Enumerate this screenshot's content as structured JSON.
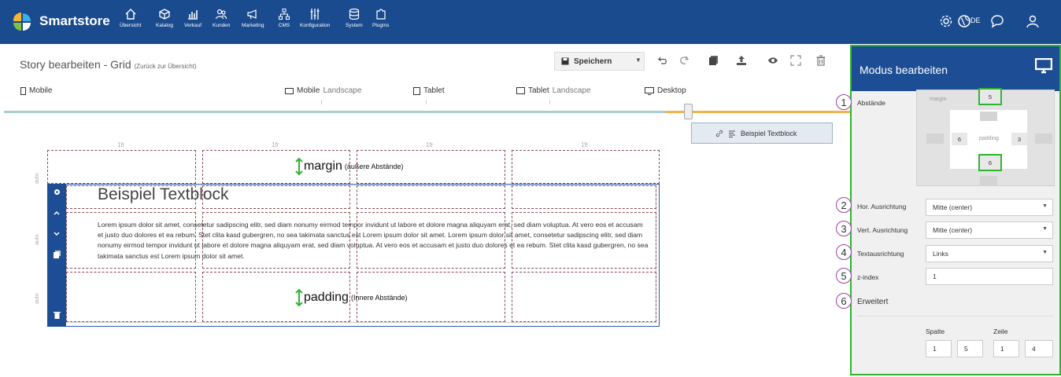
{
  "app": {
    "name": "Smartstore",
    "nav": [
      {
        "label": "Übersicht",
        "icon": "home-icon"
      },
      {
        "label": "Katalog",
        "icon": "cube-icon"
      },
      {
        "label": "Verkauf",
        "icon": "chart-icon"
      },
      {
        "label": "Kunden",
        "icon": "users-icon"
      },
      {
        "label": "Marketing",
        "icon": "megaphone-icon"
      },
      {
        "label": "CMS",
        "icon": "sitemap-icon"
      },
      {
        "label": "Konfiguration",
        "icon": "sliders-icon"
      },
      {
        "label": "System",
        "icon": "database-icon"
      },
      {
        "label": "Plugins",
        "icon": "puzzle-icon"
      }
    ],
    "lang": "DE"
  },
  "header": {
    "title": "Story bearbeiten - Grid",
    "back_link": "(Zurück zur Übersicht)",
    "save_label": "Speichern"
  },
  "devices": [
    {
      "bold": "Mobile",
      "light": ""
    },
    {
      "bold": "Mobile",
      "light": "Landscape"
    },
    {
      "bold": "Tablet",
      "light": ""
    },
    {
      "bold": "Tablet",
      "light": "Landscape"
    },
    {
      "bold": "Desktop",
      "light": ""
    }
  ],
  "grid": {
    "col_label": "1fr",
    "row_label": "auto",
    "block_title": "Beispiel Textblock",
    "block_text": "Lorem ipsum dolor sit amet, consetetur sadipscing elitr, sed diam nonumy eirmod tempor invidunt ut labore et dolore magna aliquyam erat, sed diam voluptua. At vero eos et accusam et justo duo dolores et ea rebum. Stet clita kasd gubergren, no sea takimata sanctus est Lorem ipsum dolor sit amet. Lorem ipsum dolor sit amet, consetetur sadipscing elitr, sed diam nonumy eirmod tempor invidunt ut labore et dolore magna aliquyam erat, sed diam voluptua. At vero eos et accusam et justo duo dolores et ea rebum. Stet clita kasd gubergren, no sea takimata sanctus est Lorem ipsum dolor sit amet.",
    "margin_big": "margin",
    "margin_small": "(äußere Abstände)",
    "padding_big": "padding",
    "padding_small": "(Innere Abstände)"
  },
  "widget_item": "Beispiel Textblock",
  "panel": {
    "title": "Modus bearbeiten",
    "abstaende": "Abstände",
    "margin_label": "margin",
    "padding_label": "padding",
    "margin_top": "5",
    "padding_left": "6",
    "padding_right": "3",
    "padding_bottom": "6",
    "hor_label": "Hor. Ausrichtung",
    "hor_value": "Mitte (center)",
    "vert_label": "Vert. Ausrichtung",
    "vert_value": "Mitte (center)",
    "text_label": "Textausrichtung",
    "text_value": "Links",
    "z_label": "z-index",
    "z_value": "1",
    "extended": "Erweitert",
    "spalte": "Spalte",
    "zeile": "Zeile",
    "col_from": "1",
    "col_to": "5",
    "row_from": "1",
    "row_to": "4",
    "markers": [
      "1",
      "2",
      "3",
      "4",
      "5",
      "6"
    ]
  }
}
